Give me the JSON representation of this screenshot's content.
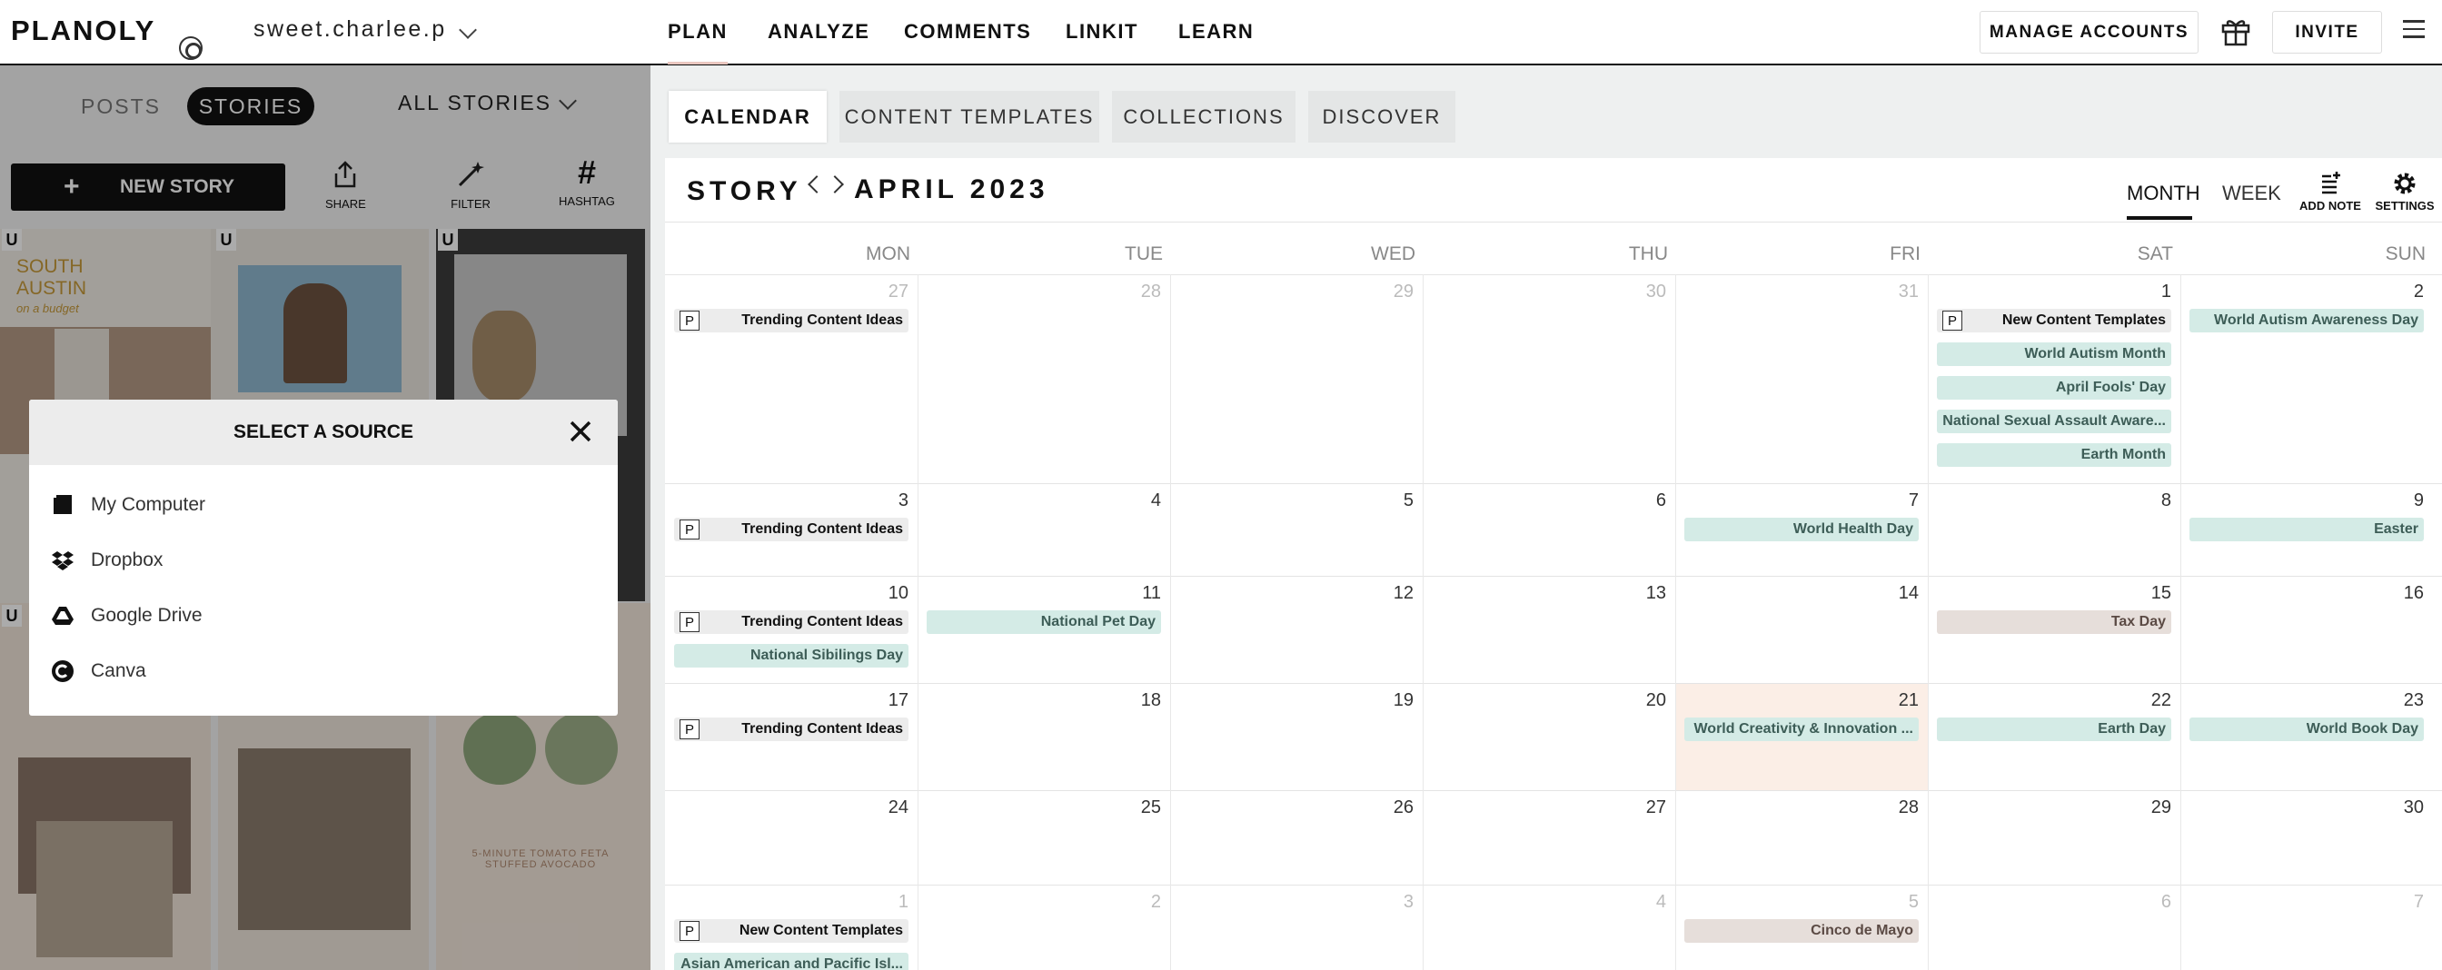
{
  "header": {
    "logo": "PLANOLY",
    "account": "sweet.charlee.p",
    "nav": [
      "PLAN",
      "ANALYZE",
      "COMMENTS",
      "LINKIT",
      "LEARN"
    ],
    "manage_accounts": "MANAGE ACCOUNTS",
    "invite": "INVITE"
  },
  "left_panel": {
    "posts_tab": "POSTS",
    "stories_tab": "STORIES",
    "filter_select": "ALL STORIES",
    "new_story": "NEW STORY",
    "tools": [
      "SHARE",
      "FILTER",
      "HASHTAG"
    ],
    "badge": "U",
    "tile_texts": {
      "south_austin": "SOUTH AUSTIN",
      "on_a_budget": "on a budget",
      "tomato": "5-MINUTE TOMATO FETA STUFFED AVOCADO"
    }
  },
  "source_dialog": {
    "title": "SELECT A SOURCE",
    "sources": [
      "My Computer",
      "Dropbox",
      "Google Drive",
      "Canva"
    ]
  },
  "calendar_tabs": [
    "CALENDAR",
    "CONTENT TEMPLATES",
    "COLLECTIONS",
    "DISCOVER"
  ],
  "calendar": {
    "label": "STORY",
    "month": "APRIL 2023",
    "views": [
      "MONTH",
      "WEEK"
    ],
    "add_note": "ADD NOTE",
    "settings": "SETTINGS",
    "days": [
      "MON",
      "TUE",
      "WED",
      "THU",
      "FRI",
      "SAT",
      "SUN"
    ],
    "weeks": [
      {
        "dates": [
          "27",
          "28",
          "29",
          "30",
          "31",
          "1",
          "2"
        ],
        "dim": [
          true,
          true,
          true,
          true,
          true,
          false,
          false
        ]
      },
      {
        "dates": [
          "3",
          "4",
          "5",
          "6",
          "7",
          "8",
          "9"
        ],
        "dim": [
          false,
          false,
          false,
          false,
          false,
          false,
          false
        ]
      },
      {
        "dates": [
          "10",
          "11",
          "12",
          "13",
          "14",
          "15",
          "16"
        ],
        "dim": [
          false,
          false,
          false,
          false,
          false,
          false,
          false
        ]
      },
      {
        "dates": [
          "17",
          "18",
          "19",
          "20",
          "21",
          "22",
          "23"
        ],
        "dim": [
          false,
          false,
          false,
          false,
          false,
          false,
          false
        ]
      },
      {
        "dates": [
          "24",
          "25",
          "26",
          "27",
          "28",
          "29",
          "30"
        ],
        "dim": [
          false,
          false,
          false,
          false,
          false,
          false,
          false
        ]
      },
      {
        "dates": [
          "1",
          "2",
          "3",
          "4",
          "5",
          "6",
          "7"
        ],
        "dim": [
          true,
          true,
          true,
          true,
          true,
          true,
          true
        ]
      }
    ],
    "events": [
      {
        "week": 0,
        "day": 0,
        "slot": 0,
        "kind": "post",
        "text": "Trending Content Ideas"
      },
      {
        "week": 0,
        "day": 5,
        "slot": 0,
        "kind": "post",
        "text": "New Content Templates"
      },
      {
        "week": 0,
        "day": 5,
        "slot": 1,
        "kind": "teal",
        "text": "World Autism Month"
      },
      {
        "week": 0,
        "day": 5,
        "slot": 2,
        "kind": "teal",
        "text": "April Fools' Day"
      },
      {
        "week": 0,
        "day": 5,
        "slot": 3,
        "kind": "teal",
        "text": "National Sexual Assault Aware..."
      },
      {
        "week": 0,
        "day": 5,
        "slot": 4,
        "kind": "teal",
        "text": "Earth Month"
      },
      {
        "week": 0,
        "day": 6,
        "slot": 0,
        "kind": "teal",
        "text": "World Autism Awareness Day"
      },
      {
        "week": 1,
        "day": 0,
        "slot": 0,
        "kind": "post",
        "text": "Trending Content Ideas"
      },
      {
        "week": 1,
        "day": 4,
        "slot": 0,
        "kind": "teal",
        "text": "World Health Day"
      },
      {
        "week": 1,
        "day": 6,
        "slot": 0,
        "kind": "teal",
        "text": "Easter"
      },
      {
        "week": 2,
        "day": 0,
        "slot": 0,
        "kind": "post",
        "text": "Trending Content Ideas"
      },
      {
        "week": 2,
        "day": 0,
        "slot": 1,
        "kind": "teal",
        "text": "National Sibilings Day"
      },
      {
        "week": 2,
        "day": 1,
        "slot": 0,
        "kind": "teal",
        "text": "National Pet Day"
      },
      {
        "week": 2,
        "day": 5,
        "slot": 0,
        "kind": "beige",
        "text": "Tax Day"
      },
      {
        "week": 3,
        "day": 0,
        "slot": 0,
        "kind": "post",
        "text": "Trending Content Ideas"
      },
      {
        "week": 3,
        "day": 4,
        "slot": 0,
        "kind": "teal",
        "text": "World Creativity & Innovation ..."
      },
      {
        "week": 3,
        "day": 5,
        "slot": 0,
        "kind": "teal",
        "text": "Earth Day"
      },
      {
        "week": 3,
        "day": 6,
        "slot": 0,
        "kind": "teal",
        "text": "World Book Day"
      },
      {
        "week": 5,
        "day": 0,
        "slot": 0,
        "kind": "post",
        "text": "New Content Templates"
      },
      {
        "week": 5,
        "day": 0,
        "slot": 1,
        "kind": "teal",
        "text": "Asian American and Pacific Isl..."
      },
      {
        "week": 5,
        "day": 4,
        "slot": 0,
        "kind": "beige",
        "text": "Cinco de Mayo"
      }
    ],
    "post_marker": "P",
    "highlight": {
      "week": 3,
      "day": 4,
      "color": "#fbeee6"
    },
    "colors": {
      "teal": "#d4ebe6",
      "beige": "#e6deda",
      "accent_underline": "#e9c7c0"
    }
  }
}
